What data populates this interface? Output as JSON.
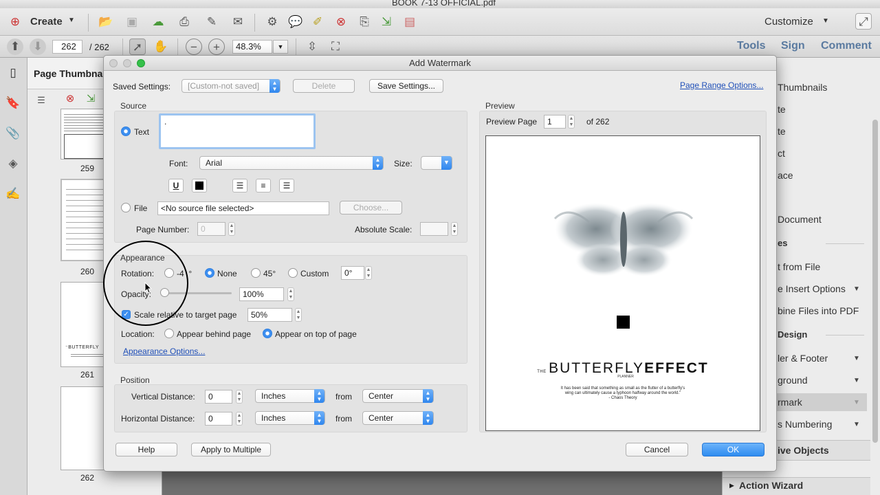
{
  "window": {
    "title": "BOOK 7-13 OFFICIAL.pdf"
  },
  "toolbar1": {
    "create_label": "Create",
    "customize_label": "Customize"
  },
  "toolbar2": {
    "page_current": "262",
    "page_total": "/  262",
    "zoom": "48.3%",
    "tools": "Tools",
    "sign": "Sign",
    "comment": "Comment"
  },
  "thumbnails": {
    "title": "Page Thumbnails",
    "pages": [
      "259",
      "260",
      "261",
      "262"
    ]
  },
  "right_panel": {
    "items": [
      " Thumbnails",
      "te",
      "te",
      "ct",
      "ace",
      " Document",
      "es",
      "t from File",
      "e Insert Options",
      "bine Files into PDF",
      " Design",
      "ler & Footer",
      "ground",
      "rmark",
      "s Numbering",
      "ive Objects",
      "Action Wizard"
    ]
  },
  "dialog": {
    "title": "Add Watermark",
    "saved_settings_label": "Saved Settings:",
    "saved_settings_value": "[Custom-not saved]",
    "delete_label": "Delete",
    "save_settings_label": "Save Settings...",
    "page_range_label": "Page Range Options...",
    "source": {
      "title": "Source",
      "text_label": "Text",
      "text_value": ".",
      "font_label": "Font:",
      "font_value": "Arial",
      "size_label": "Size:",
      "underline": "U",
      "file_label": "File",
      "file_value": "<No source file selected>",
      "choose_label": "Choose...",
      "page_number_label": "Page Number:",
      "page_number_value": "0",
      "absolute_scale_label": "Absolute Scale:"
    },
    "appearance": {
      "title": "Appearance",
      "rotation_label": "Rotation:",
      "rot_neg45": "-4",
      "rot_neg45_deg": "°",
      "rot_none": "None",
      "rot_45": "45°",
      "rot_custom": "Custom",
      "custom_value": "0°",
      "opacity_label": "Opacity:",
      "opacity_value": "100%",
      "opacity_level": 1.0,
      "scale_label": "Scale relative to target page",
      "scale_value": "50%",
      "location_label": "Location:",
      "behind_label": "Appear behind page",
      "on_top_label": "Appear on top of page",
      "options_link": "Appearance Options..."
    },
    "position": {
      "title": "Position",
      "vertical_label": "Vertical Distance:",
      "vertical_value": "0",
      "vertical_unit": "Inches",
      "vertical_from_label": "from",
      "vertical_from": "Center",
      "horizontal_label": "Horizontal Distance:",
      "horizontal_value": "0",
      "horizontal_unit": "Inches",
      "horizontal_from_label": "from",
      "horizontal_from": "Center"
    },
    "preview": {
      "title": "Preview",
      "page_label": "Preview Page",
      "page_value": "1",
      "of_label": "of 262",
      "brand_prefix": "THE",
      "brand_name": "BUTTERFLY",
      "brand_bold": "EFFECT",
      "brand_sub": "PLANNER",
      "quote_line1": "It has been said that something as small as the flutter of a butterfly's",
      "quote_line2": "wing can ultimately cause a typhoon halfway around the world.\"",
      "quote_line3": "- Chaos Theory"
    },
    "help_label": "Help",
    "apply_multiple_label": "Apply to Multiple",
    "cancel_label": "Cancel",
    "ok_label": "OK"
  },
  "colors": {
    "accent": "#3d8ff0",
    "link": "#1f4fb8"
  }
}
